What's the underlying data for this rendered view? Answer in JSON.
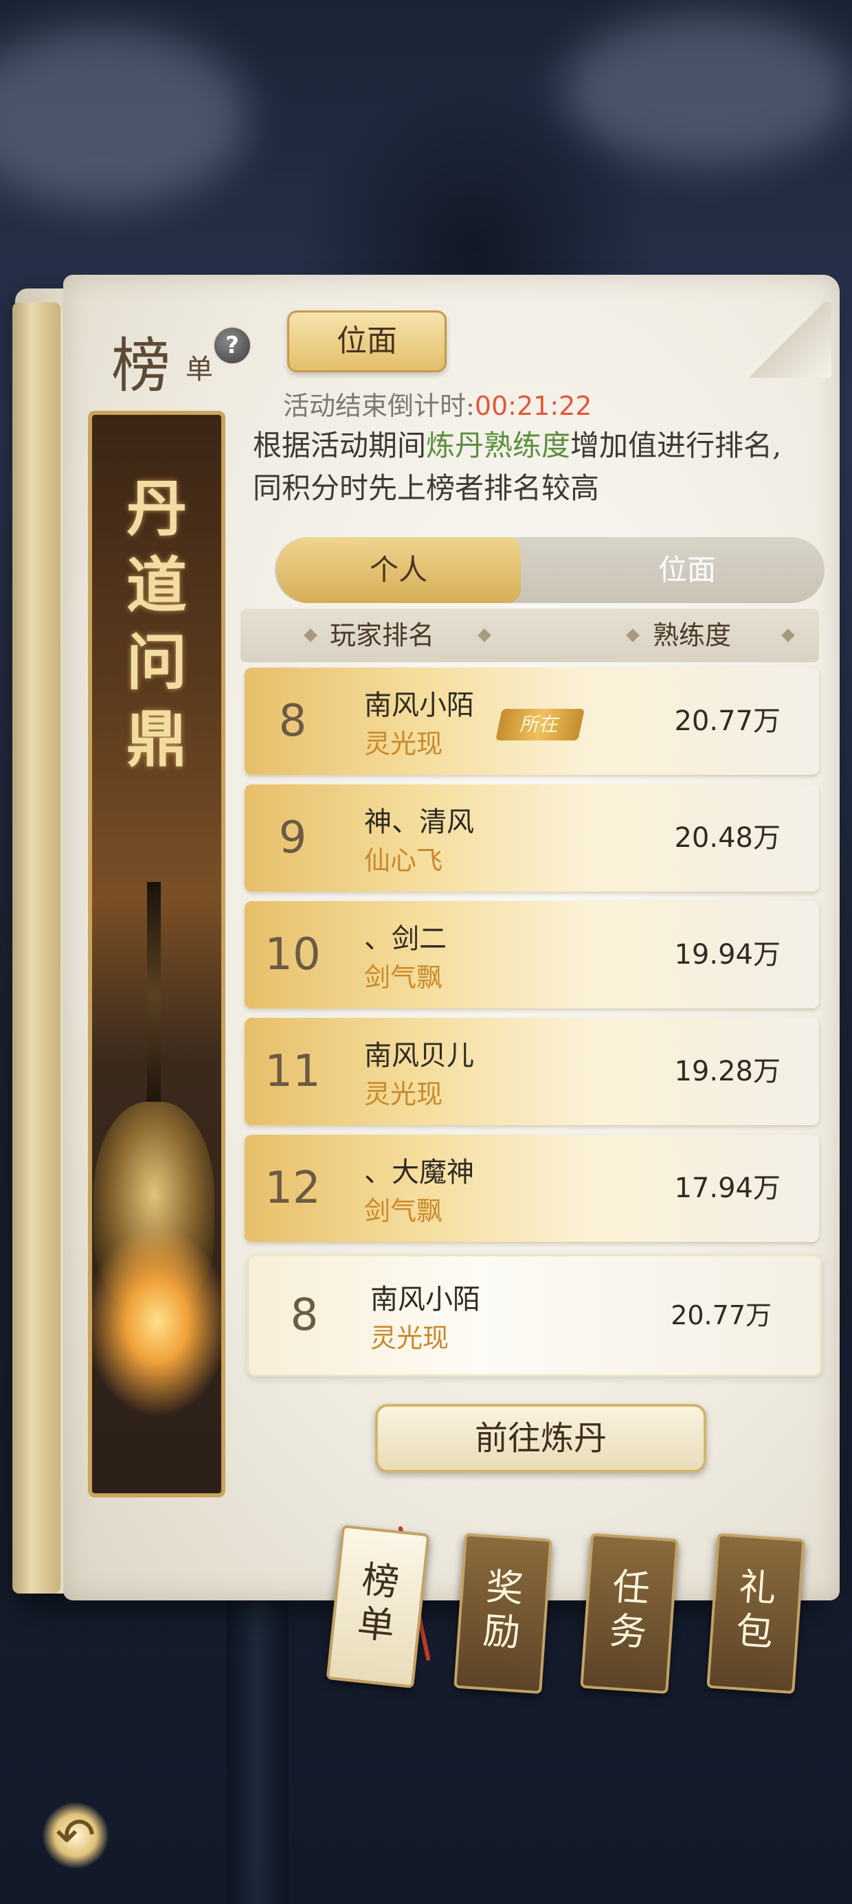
{
  "header": {
    "board_big": "榜",
    "board_small": "单",
    "help": "?",
    "plane_button": "位面",
    "countdown_label": "活动结束倒计时:",
    "countdown_value": "00:21:22",
    "description_pre": "根据活动期间",
    "description_highlight": "炼丹熟练度",
    "description_post": "增加值进行排名,同积分时先上榜者排名较高"
  },
  "banner": {
    "title": "丹道问鼎"
  },
  "tabs": {
    "personal": "个人",
    "plane": "位面",
    "active": "个人"
  },
  "columns": {
    "player_rank": "玩家排名",
    "proficiency": "熟练度"
  },
  "rows": [
    {
      "rank": "8",
      "name": "南风小陌",
      "title": "灵光现",
      "score": "20.77万",
      "badge": "所在"
    },
    {
      "rank": "9",
      "name": "神、清风",
      "title": "仙心飞",
      "score": "20.48万"
    },
    {
      "rank": "10",
      "name": "、剑二",
      "title": "剑气飘",
      "score": "19.94万"
    },
    {
      "rank": "11",
      "name": "南风贝儿",
      "title": "灵光现",
      "score": "19.28万"
    },
    {
      "rank": "12",
      "name": "、大魔神",
      "title": "剑气飘",
      "score": "17.94万"
    }
  ],
  "self_row": {
    "rank": "8",
    "name": "南风小陌",
    "title": "灵光现",
    "score": "20.77万"
  },
  "go_button": "前往炼丹",
  "bottom_tabs": {
    "ranking": "榜\n单",
    "reward": "奖\n励",
    "task": "任\n务",
    "gift": "礼\n包",
    "active": "榜单"
  },
  "colors": {
    "countdown": "#e1573a",
    "highlight": "#5a8f3d",
    "title_gold": "#c9892b"
  },
  "icons": {
    "help": "question-icon",
    "back": "back-arrow-icon"
  }
}
